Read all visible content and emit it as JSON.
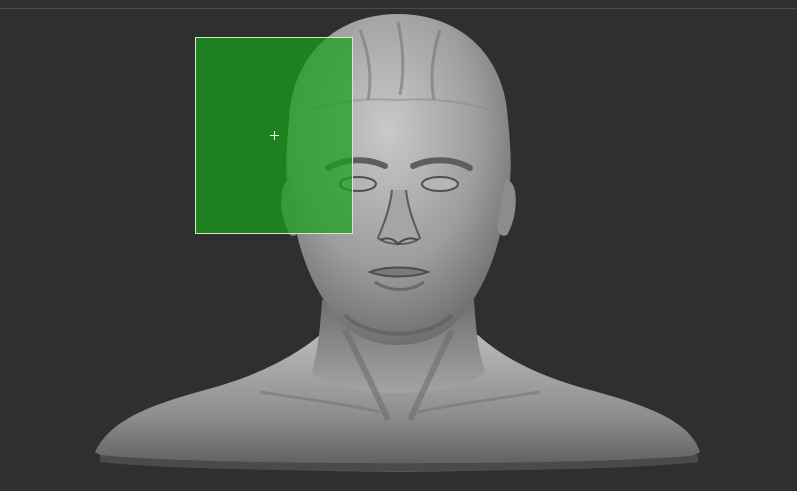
{
  "app": {
    "viewport_background": "#2f2f2f"
  },
  "model": {
    "subject": "sculpted-male-bust",
    "material_color": "#9a9a9a"
  },
  "selection": {
    "fill_color": "#18a018",
    "border_color": "#cfe9c9",
    "cursor_icon": "crosshair-icon"
  }
}
